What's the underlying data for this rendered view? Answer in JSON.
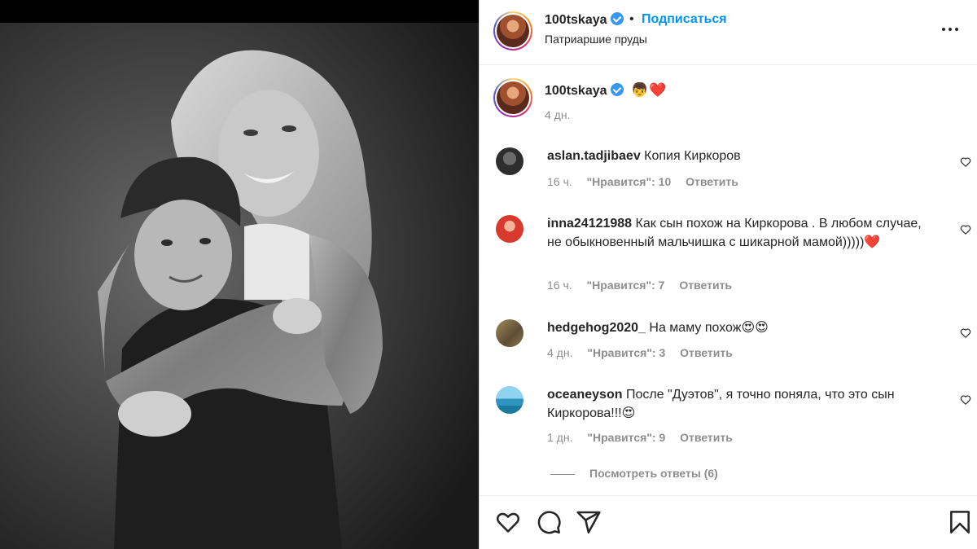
{
  "post": {
    "username": "100tskaya",
    "follow_label": "Подписаться",
    "separator": "•",
    "location": "Патриаршие пруды",
    "caption_emojis": [
      "👦",
      "❤️"
    ],
    "caption_time": "4 дн."
  },
  "comments": [
    {
      "username": "aslan.tadjibaev",
      "text": "Копия Киркоров",
      "time": "16 ч.",
      "likes": "\"Нравится\": 10",
      "reply": "Ответить",
      "avatar_color": "#3a3a3a"
    },
    {
      "username": "inna24121988",
      "text": "Как сын похож на Киркорова . В любом случае, не обыкновенный мальчишка с шикарной мамой)))))❤️",
      "time": "16 ч.",
      "likes": "\"Нравится\": 7",
      "reply": "Ответить",
      "avatar_color": "#e0413a"
    },
    {
      "username": "hedgehog2020_",
      "text": "На маму похож😍😍",
      "time": "4 дн.",
      "likes": "\"Нравится\": 3",
      "reply": "Ответить",
      "avatar_color": "#7b6a4a"
    },
    {
      "username": "oceaneyson",
      "text": "После \"Дуэтов\", я точно поняла, что это сын Киркорова!!!😍",
      "time": "1 дн.",
      "likes": "\"Нравится\": 9",
      "reply": "Ответить",
      "avatar_color": "#3fa7c9"
    }
  ],
  "view_replies": "Посмотреть ответы (6)",
  "icons": {
    "more": "more-options-icon",
    "like": "heart-icon",
    "comment": "comment-icon",
    "share": "share-icon",
    "save": "bookmark-icon"
  }
}
